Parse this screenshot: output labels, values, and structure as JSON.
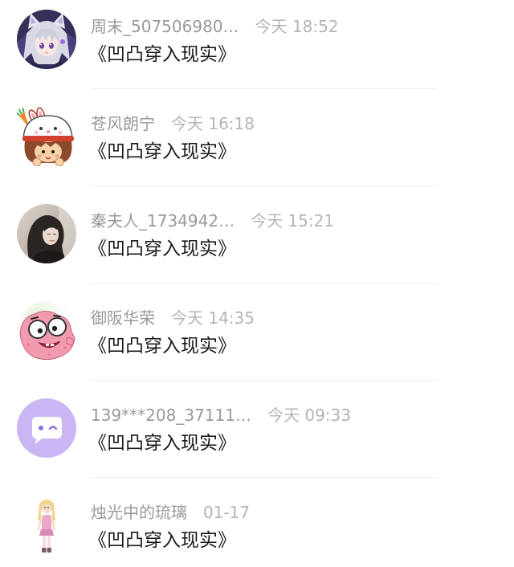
{
  "list": {
    "items": [
      {
        "name": "周末_507506980…",
        "time": "今天 18:52",
        "message": "《凹凸穿入现实》",
        "avatar_icon": "anime-girl-avatar"
      },
      {
        "name": "苍风朗宁",
        "time": "今天 16:18",
        "message": "《凹凸穿入现实》",
        "avatar_icon": "bunny-hat-cartoon-avatar"
      },
      {
        "name": "秦夫人_1734942…",
        "time": "今天 15:21",
        "message": "《凹凸穿入现实》",
        "avatar_icon": "portrait-photo-avatar"
      },
      {
        "name": "御阪华荣",
        "time": "今天 14:35",
        "message": "《凹凸穿入现实》",
        "avatar_icon": "pink-starfish-cartoon-avatar"
      },
      {
        "name": "139***208_37111…",
        "time": "今天 09:33",
        "message": "《凹凸穿入现实》",
        "avatar_icon": "chat-bubble-default-avatar"
      },
      {
        "name": "烛光中的琉璃",
        "time": "01-17",
        "message": "《凹凸穿入现实》",
        "avatar_icon": "doll-figure-avatar"
      }
    ]
  },
  "colors": {
    "name": "#999999",
    "time": "#b4b4b4",
    "message": "#1a1a1a",
    "divider": "#efefef",
    "default_avatar": "#cab6f4"
  }
}
